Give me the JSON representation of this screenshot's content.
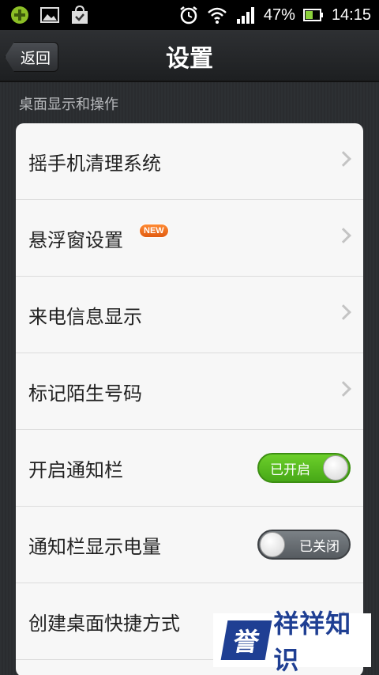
{
  "status_bar": {
    "battery": "47%",
    "time": "14:15",
    "icons": [
      "app-icon",
      "image-icon",
      "shopping-bag-icon",
      "alarm-icon",
      "wifi-icon",
      "signal-icon",
      "battery-icon"
    ]
  },
  "header": {
    "back_label": "返回",
    "title": "设置"
  },
  "section": {
    "title": "桌面显示和操作"
  },
  "rows": [
    {
      "label": "摇手机清理系统",
      "type": "nav"
    },
    {
      "label": "悬浮窗设置",
      "type": "nav",
      "badge": "NEW"
    },
    {
      "label": "来电信息显示",
      "type": "nav"
    },
    {
      "label": "标记陌生号码",
      "type": "nav"
    },
    {
      "label": "开启通知栏",
      "type": "toggle",
      "toggle_text": "已开启",
      "state": "on"
    },
    {
      "label": "通知栏显示电量",
      "type": "toggle",
      "toggle_text": "已关闭",
      "state": "off"
    },
    {
      "label": "创建桌面快捷方式",
      "type": "nav"
    }
  ],
  "watermark": {
    "badge": "誉",
    "text": "祥祥知识"
  },
  "colors": {
    "toggle_on": "#47a817",
    "toggle_off": "#565b60",
    "badge_new": "#e05a10",
    "watermark": "#1f3f93"
  }
}
